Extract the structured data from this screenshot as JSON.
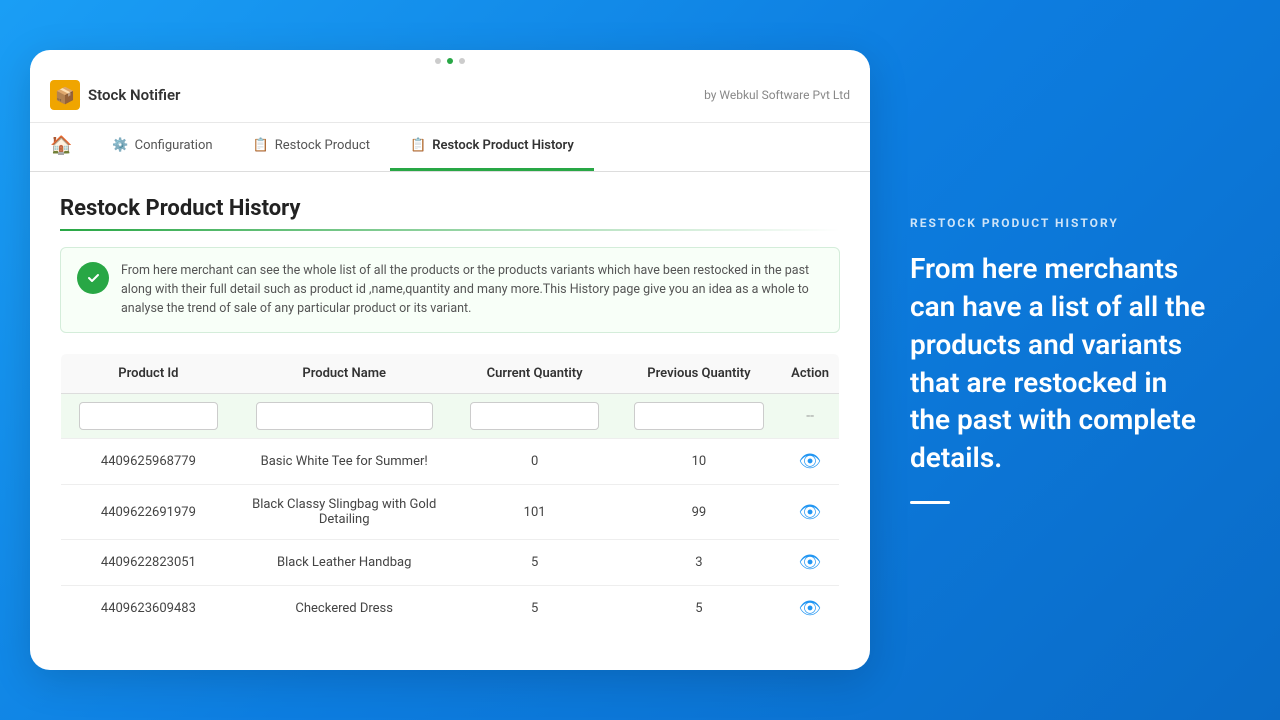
{
  "header": {
    "brand_name": "Stock Notifier",
    "logo_emoji": "📦",
    "by_label": "by Webkul Software Pvt Ltd"
  },
  "nav": {
    "tabs": [
      {
        "id": "home",
        "label": "🏠",
        "is_home": true,
        "active": false
      },
      {
        "id": "configuration",
        "label": "Configuration",
        "icon": "⚙️",
        "active": false
      },
      {
        "id": "restock-product",
        "label": "Restock Product",
        "icon": "📋",
        "active": false
      },
      {
        "id": "restock-product-history",
        "label": "Restock Product History",
        "icon": "📋",
        "active": true
      }
    ]
  },
  "page": {
    "title": "Restock Product History",
    "info_text": "From here merchant can see the whole list of all the products or the products variants which have been restocked in the past along with their full detail such as product id ,name,quantity and many more.This History page give you an idea as a whole to analyse the trend of sale of any particular product or its variant."
  },
  "table": {
    "columns": [
      "Product Id",
      "Product Name",
      "Current Quantity",
      "Previous Quantity",
      "Action"
    ],
    "filter_placeholder": "",
    "action_dash": "--",
    "rows": [
      {
        "product_id": "4409625968779",
        "product_name": "Basic White Tee for Summer!",
        "current_qty": "0",
        "previous_qty": "10"
      },
      {
        "product_id": "4409622691979",
        "product_name": "Black Classy Slingbag with Gold Detailing",
        "current_qty": "101",
        "previous_qty": "99"
      },
      {
        "product_id": "4409622823051",
        "product_name": "Black Leather Handbag",
        "current_qty": "5",
        "previous_qty": "3"
      },
      {
        "product_id": "4409623609483",
        "product_name": "Checkered Dress",
        "current_qty": "5",
        "previous_qty": "5"
      }
    ]
  },
  "right_panel": {
    "subtitle": "RESTOCK PRODUCT HISTORY",
    "description": "From here merchants can have a list of all the products and variants that are restocked in the past with complete details."
  }
}
